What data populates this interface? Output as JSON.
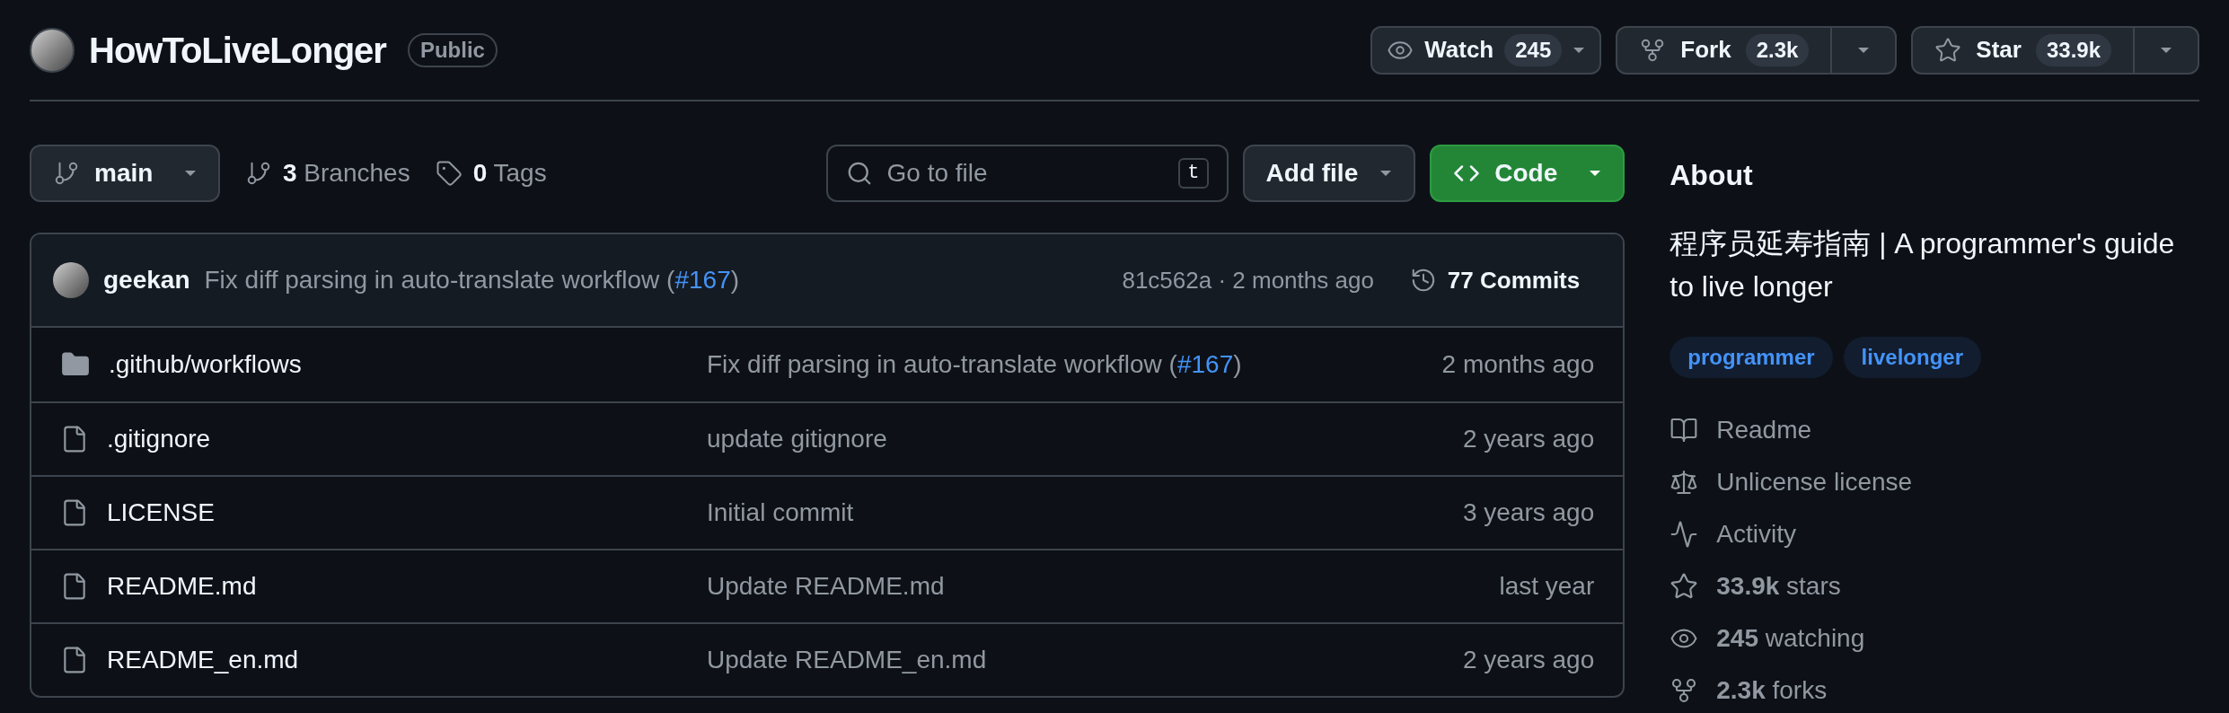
{
  "header": {
    "repo_name": "HowToLiveLonger",
    "visibility": "Public",
    "actions": [
      {
        "kind": "watch",
        "label": "Watch",
        "count": "245"
      },
      {
        "kind": "fork",
        "label": "Fork",
        "count": "2.3k"
      },
      {
        "kind": "star",
        "label": "Star",
        "count": "33.9k"
      }
    ]
  },
  "toolbar": {
    "branch": "main",
    "branches": {
      "count": "3",
      "label": "Branches"
    },
    "tags": {
      "count": "0",
      "label": "Tags"
    },
    "search": {
      "placeholder": "Go to file",
      "shortcut": "t"
    },
    "add_file": "Add file",
    "code": "Code"
  },
  "latest_commit": {
    "author": "geekan",
    "message": "Fix diff parsing in auto-translate workflow (",
    "pr_link": "#167",
    "message_end": ")",
    "meta": "81c562a · 2 months ago",
    "commits": "77 Commits"
  },
  "files": [
    {
      "kind": "folder",
      "name": ".github/workflows",
      "message": "Fix diff parsing in auto-translate workflow (",
      "pr_link": "#167",
      "message_end": ")",
      "time": "2 months ago"
    },
    {
      "kind": "file",
      "name": ".gitignore",
      "message": "update gitignore",
      "time": "2 years ago"
    },
    {
      "kind": "file",
      "name": "LICENSE",
      "message": "Initial commit",
      "time": "3 years ago"
    },
    {
      "kind": "file",
      "name": "README.md",
      "message": "Update README.md",
      "time": "last year"
    },
    {
      "kind": "file",
      "name": "README_en.md",
      "message": "Update README_en.md",
      "time": "2 years ago"
    }
  ],
  "about": {
    "title": "About",
    "description": "程序员延寿指南 | A programmer's guide to live longer",
    "topics": [
      "programmer",
      "livelonger"
    ],
    "links": [
      {
        "kind": "readme",
        "text": "Readme"
      },
      {
        "kind": "license",
        "text": "Unlicense license"
      },
      {
        "kind": "activity",
        "text": "Activity"
      },
      {
        "kind": "stars",
        "text": "**33.9k** stars"
      },
      {
        "kind": "watching",
        "text": "**245** watching"
      },
      {
        "kind": "forks",
        "text": "**2.3k** forks"
      }
    ]
  }
}
